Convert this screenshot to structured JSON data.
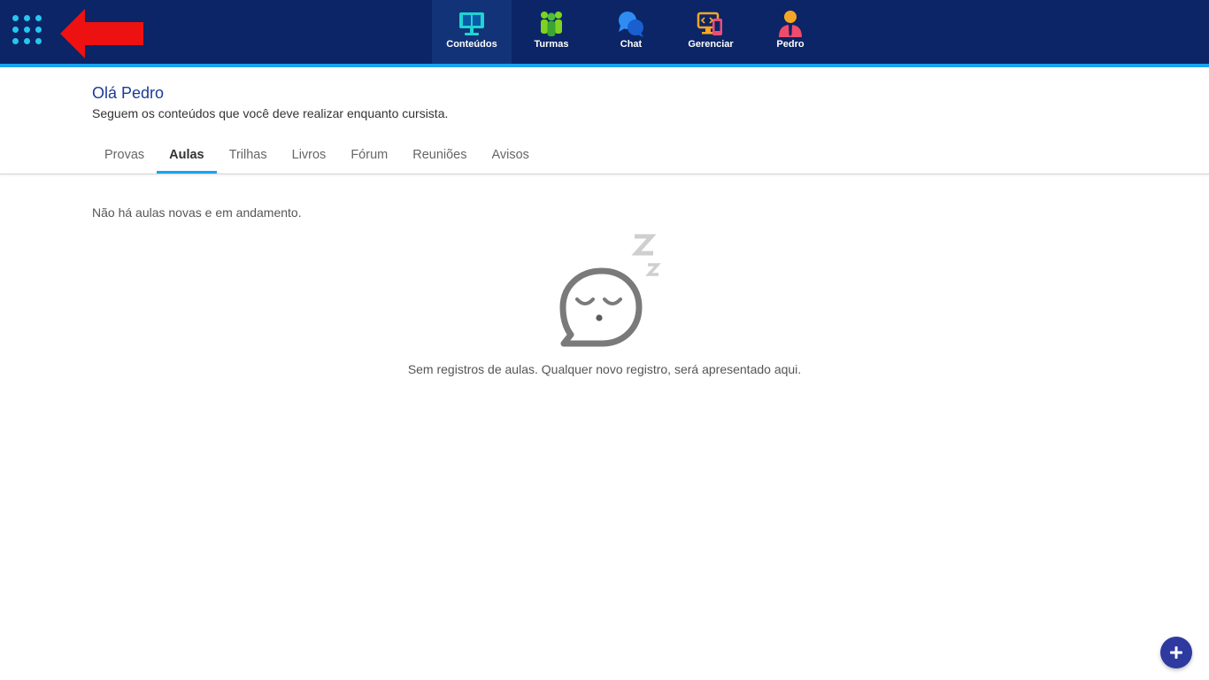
{
  "topbar": {
    "nav_items": [
      {
        "label": "Conteúdos",
        "icon": "monitor-book-icon",
        "active": true
      },
      {
        "label": "Turmas",
        "icon": "group-people-icon",
        "active": false
      },
      {
        "label": "Chat",
        "icon": "chat-bubbles-icon",
        "active": false
      },
      {
        "label": "Gerenciar",
        "icon": "manage-devices-icon",
        "active": false
      },
      {
        "label": "Pedro",
        "icon": "user-profile-icon",
        "active": false
      }
    ]
  },
  "greeting": {
    "hello": "Olá",
    "name": "Pedro",
    "subtitle": "Seguem os conteúdos que você deve realizar enquanto cursista."
  },
  "tabs": [
    {
      "label": "Provas",
      "active": false
    },
    {
      "label": "Aulas",
      "active": true
    },
    {
      "label": "Trilhas",
      "active": false
    },
    {
      "label": "Livros",
      "active": false
    },
    {
      "label": "Fórum",
      "active": false
    },
    {
      "label": "Reuniões",
      "active": false
    },
    {
      "label": "Avisos",
      "active": false
    }
  ],
  "content": {
    "empty_note": "Não há aulas novas e em andamento.",
    "empty_message": "Sem registros de aulas. Qualquer novo registro, será apresentado aqui."
  },
  "colors": {
    "topbar": "#0b2566",
    "accent": "#1aa3ef",
    "greeting": "#1c3a9a",
    "fab": "#2e3a9f"
  }
}
